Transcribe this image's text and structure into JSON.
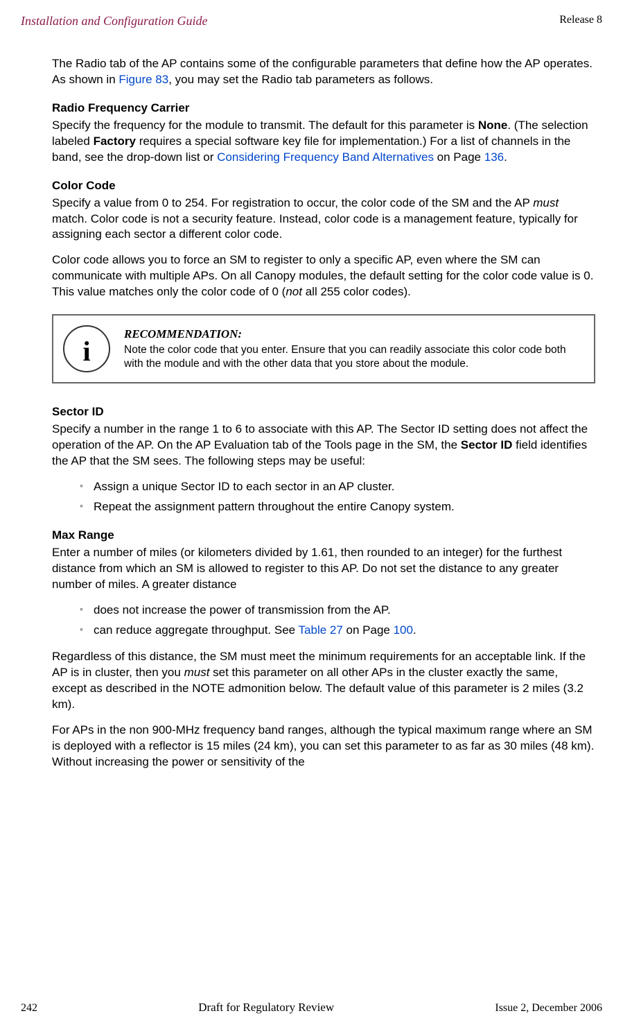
{
  "header": {
    "left": "Installation and Configuration Guide",
    "right": "Release 8"
  },
  "intro": {
    "p1a": "The Radio tab of the AP contains some of the configurable parameters that define how the AP operates. As shown in ",
    "link1": "Figure 83",
    "p1b": ", you may set the Radio tab parameters as follows."
  },
  "rfc": {
    "head": "Radio Frequency Carrier",
    "p1a": "Specify the frequency for the module to transmit. The default for this parameter is ",
    "none": "None",
    "p1b": ". (The selection labeled ",
    "factory": "Factory",
    "p1c": " requires a special software key file for implementation.) For a list of channels in the band, see the drop-down list or ",
    "link": "Considering Frequency Band Alternatives",
    "p1d": " on Page ",
    "page": "136",
    "p1e": "."
  },
  "cc": {
    "head": "Color Code",
    "p1a": "Specify a value from 0 to 254. For registration to occur, the color code of the SM and the AP ",
    "must": "must",
    "p1b": " match. Color code is not a security feature. Instead, color code is a management feature, typically for assigning each sector a different color code.",
    "p2a": "Color code allows you to force an SM to register to only a specific AP, even where the SM can communicate with multiple APs. On all Canopy modules, the default setting for the color code value is 0. This value matches only the color code of 0 (",
    "not": "not",
    "p2b": " all 255 color codes)."
  },
  "rec": {
    "title": "RECOMMENDATION:",
    "body": "Note the color code that you enter. Ensure that you can readily associate this color code both with the module and with the other data that you store about the module."
  },
  "sid": {
    "head": "Sector ID",
    "p1a": "Specify a number in the range 1 to 6 to associate with this AP. The Sector ID setting does not affect the operation of the AP. On the AP Evaluation tab of the Tools page in the SM, the ",
    "bold": "Sector ID",
    "p1b": " field identifies the AP that the SM sees. The following steps may be useful:",
    "bullets": [
      "Assign a unique Sector ID to each sector in an AP cluster.",
      "Repeat the assignment pattern throughout the entire Canopy system."
    ]
  },
  "mr": {
    "head": "Max Range",
    "p1": "Enter a number of miles (or kilometers divided by 1.61, then rounded to an integer) for the furthest distance from which an SM is allowed to register to this AP. Do not set the distance to any greater number of miles. A greater distance",
    "b1": "does not increase the power of transmission from the AP.",
    "b2a": "can reduce aggregate throughput. See ",
    "b2link": "Table 27",
    "b2b": " on Page ",
    "b2page": "100",
    "b2c": ".",
    "p2a": "Regardless of this distance, the SM must meet the minimum requirements for an acceptable link. If the AP is in cluster, then you ",
    "must": "must",
    "p2b": " set this parameter on all other APs in the cluster exactly the same, except as described in the NOTE admonition below. The default value of this parameter is 2 miles (3.2 km).",
    "p3": "For APs in the non 900-MHz frequency band ranges, although the typical maximum range where an SM is deployed with a reflector is 15 miles (24 km), you can set this parameter to as far as 30 miles (48 km). Without increasing the power or sensitivity of the"
  },
  "footer": {
    "left": "242",
    "center": "Draft for Regulatory Review",
    "right": "Issue 2, December 2006"
  }
}
